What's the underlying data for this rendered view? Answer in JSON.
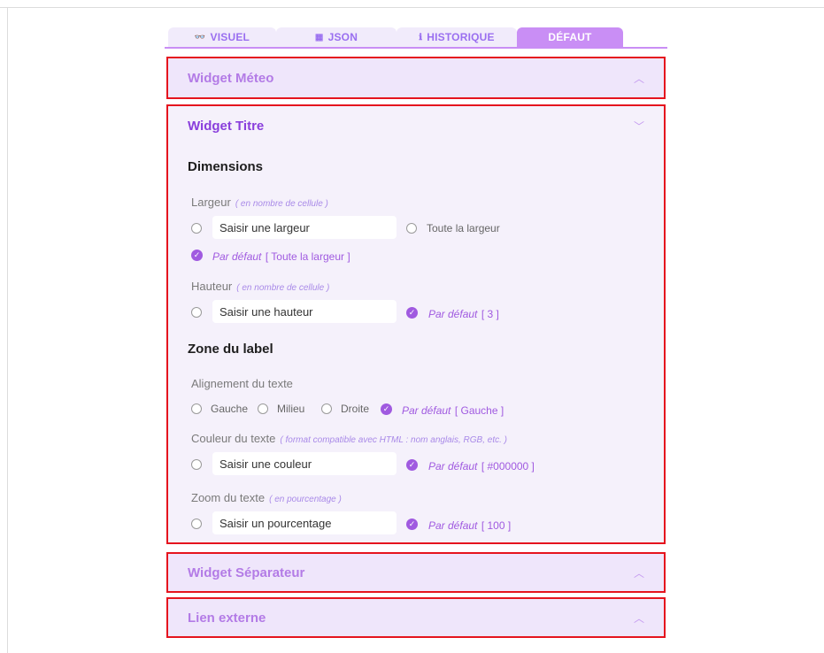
{
  "tabs": [
    {
      "icon": "👓",
      "label": "VISUEL"
    },
    {
      "icon": "▦",
      "label": "JSON"
    },
    {
      "icon": "ℹ",
      "label": "HISTORIQUE"
    },
    {
      "label": "DÉFAUT"
    }
  ],
  "sections": {
    "meteo": {
      "title": "Widget Méteo"
    },
    "titre": {
      "title": "Widget Titre",
      "dimensions": {
        "heading": "Dimensions",
        "largeur_label": "Largeur",
        "largeur_hint": "( en nombre de cellule )",
        "largeur_input": "Saisir une largeur",
        "largeur_full": "Toute la largeur",
        "largeur_default_label": "Par défaut",
        "largeur_default_value": "[ Toute la largeur ]",
        "hauteur_label": "Hauteur",
        "hauteur_hint": "( en nombre de cellule )",
        "hauteur_input": "Saisir une hauteur",
        "hauteur_default_label": "Par défaut",
        "hauteur_default_value": "[ 3 ]"
      },
      "zone": {
        "heading": "Zone du label",
        "align_label": "Alignement du texte",
        "align_left": "Gauche",
        "align_center": "Milieu",
        "align_right": "Droite",
        "align_default_label": "Par défaut",
        "align_default_value": "[ Gauche ]",
        "color_label": "Couleur du texte",
        "color_hint": "( format compatible avec HTML : nom anglais, RGB, etc. )",
        "color_input": "Saisir une couleur",
        "color_default_label": "Par défaut",
        "color_default_value": "[ #000000 ]",
        "zoom_label": "Zoom du texte",
        "zoom_hint": "( en pourcentage )",
        "zoom_input": "Saisir un pourcentage",
        "zoom_default_label": "Par défaut",
        "zoom_default_value": "[ 100 ]"
      }
    },
    "separateur": {
      "title": "Widget Séparateur"
    },
    "lien": {
      "title": "Lien externe"
    }
  },
  "colors": {
    "accent": "#a05ae0",
    "tab_active": "#c98ef5",
    "highlight_border": "#e5141e"
  }
}
